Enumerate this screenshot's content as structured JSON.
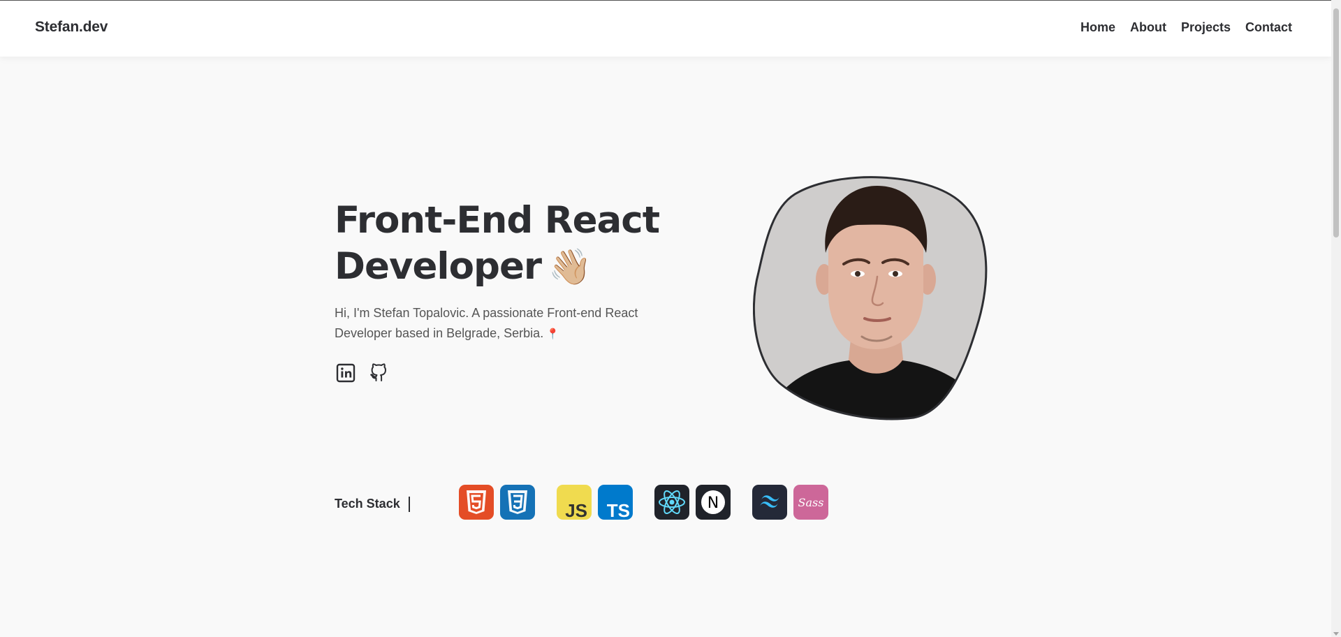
{
  "header": {
    "logo": "Stefan.dev",
    "nav": [
      {
        "label": "Home"
      },
      {
        "label": "About"
      },
      {
        "label": "Projects"
      },
      {
        "label": "Contact"
      }
    ]
  },
  "hero": {
    "title_line1": "Front-End React",
    "title_line2": "Developer",
    "title_emoji": "👋🏼",
    "intro": "Hi, I'm Stefan Topalovic. A passionate Front-end React Developer based in Belgrade, Serbia.",
    "intro_emoji": "📍",
    "socials": [
      {
        "icon": "linkedin-icon"
      },
      {
        "icon": "github-icon"
      }
    ]
  },
  "tech_stack": {
    "label": "Tech Stack",
    "icons": [
      {
        "icon": "html5-icon",
        "color": "#e44d26"
      },
      {
        "icon": "css3-icon",
        "color": "#1572b6"
      },
      {
        "icon": "javascript-icon",
        "color": "#f0db4f",
        "text": "JS"
      },
      {
        "icon": "typescript-icon",
        "color": "#007acc",
        "text": "TS"
      },
      {
        "icon": "react-icon",
        "color": "#20232a"
      },
      {
        "icon": "nextjs-icon",
        "color": "#20232a",
        "text": "N"
      },
      {
        "icon": "tailwind-icon",
        "color": "#242938"
      },
      {
        "icon": "sass-icon",
        "color": "#cd6799",
        "text": "Sass"
      }
    ]
  },
  "colors": {
    "text": "#2d2e32",
    "background": "#f9f9f9",
    "header_bg": "#ffffff"
  }
}
